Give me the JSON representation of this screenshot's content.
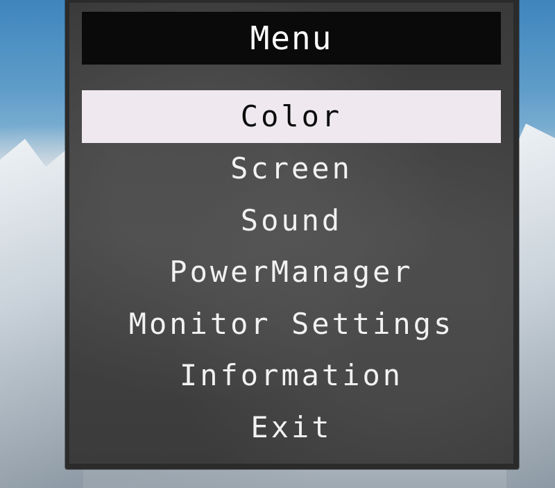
{
  "menu": {
    "title": "Menu",
    "selected_index": 0,
    "items": [
      {
        "label": "Color"
      },
      {
        "label": "Screen"
      },
      {
        "label": "Sound"
      },
      {
        "label": "PowerManager"
      },
      {
        "label": "Monitor Settings"
      },
      {
        "label": "Information"
      },
      {
        "label": "Exit"
      }
    ]
  },
  "colors": {
    "panel_background": "#3f3f3f",
    "title_bar": "#0a0a0a",
    "highlight": "#efe9ef",
    "text": "#f2f2f2",
    "selected_text": "#0c0c0c"
  }
}
